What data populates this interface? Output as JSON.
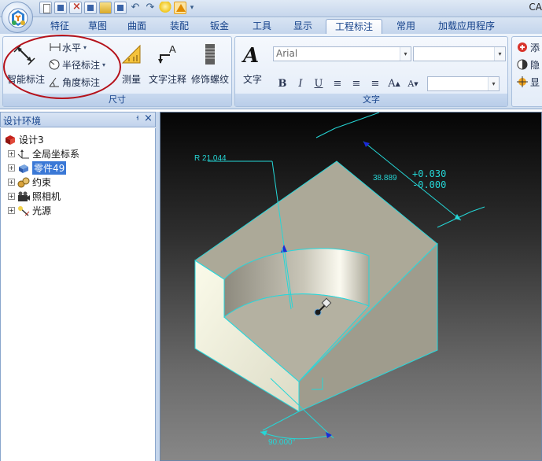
{
  "app": {
    "title_fragment": "CA"
  },
  "tabs": [
    {
      "label": "特征",
      "active": false
    },
    {
      "label": "草图",
      "active": false
    },
    {
      "label": "曲面",
      "active": false
    },
    {
      "label": "装配",
      "active": false
    },
    {
      "label": "钣金",
      "active": false
    },
    {
      "label": "工具",
      "active": false
    },
    {
      "label": "显示",
      "active": false
    },
    {
      "label": "工程标注",
      "active": true
    },
    {
      "label": "常用",
      "active": false
    },
    {
      "label": "加载应用程序",
      "active": false
    }
  ],
  "ribbon": {
    "dimension_group": {
      "label": "尺寸",
      "smart_dimension": "智能标注",
      "horizontal": "水平",
      "radius_dimension": "半径标注",
      "angle_dimension": "角度标注",
      "measure": "测量"
    },
    "annotation": {
      "text_annotation": "文字注释",
      "cosmetic_thread": "修饰螺纹"
    },
    "text_group": {
      "label": "文字",
      "text_button": "文字",
      "font_name": "Arial",
      "font_size": "",
      "style_combo": "",
      "bold": "B",
      "italic": "I",
      "underline": "U"
    },
    "right_group": {
      "add": "添",
      "hide": "隐",
      "show": "显"
    }
  },
  "panel": {
    "title": "设计环境",
    "pin": "ᅟ",
    "close": "×",
    "tree": [
      {
        "label": "设计3",
        "icon": "design-icon",
        "expander": "",
        "selected": false
      },
      {
        "label": "全局坐标系",
        "icon": "axes-icon",
        "expander": "+",
        "selected": false
      },
      {
        "label": "零件49",
        "icon": "part-icon",
        "expander": "+",
        "selected": true
      },
      {
        "label": "约束",
        "icon": "constraint-icon",
        "expander": "+",
        "selected": false
      },
      {
        "label": "照相机",
        "icon": "camera-icon",
        "expander": "+",
        "selected": false
      },
      {
        "label": "光源",
        "icon": "light-icon",
        "expander": "+",
        "selected": false
      }
    ]
  },
  "viewport": {
    "radius_label": "R 21.044",
    "linear_value": "38.889",
    "tolerance_upper": "+0.030",
    "tolerance_lower": "-0.000",
    "angle_label": "90.000°",
    "colors": {
      "dimension": "#25d6d6",
      "part_face": "#aaa596",
      "part_highlight": "#f4f2e2",
      "edge": "#27d8dc",
      "marker": "#1a2bd8"
    }
  }
}
